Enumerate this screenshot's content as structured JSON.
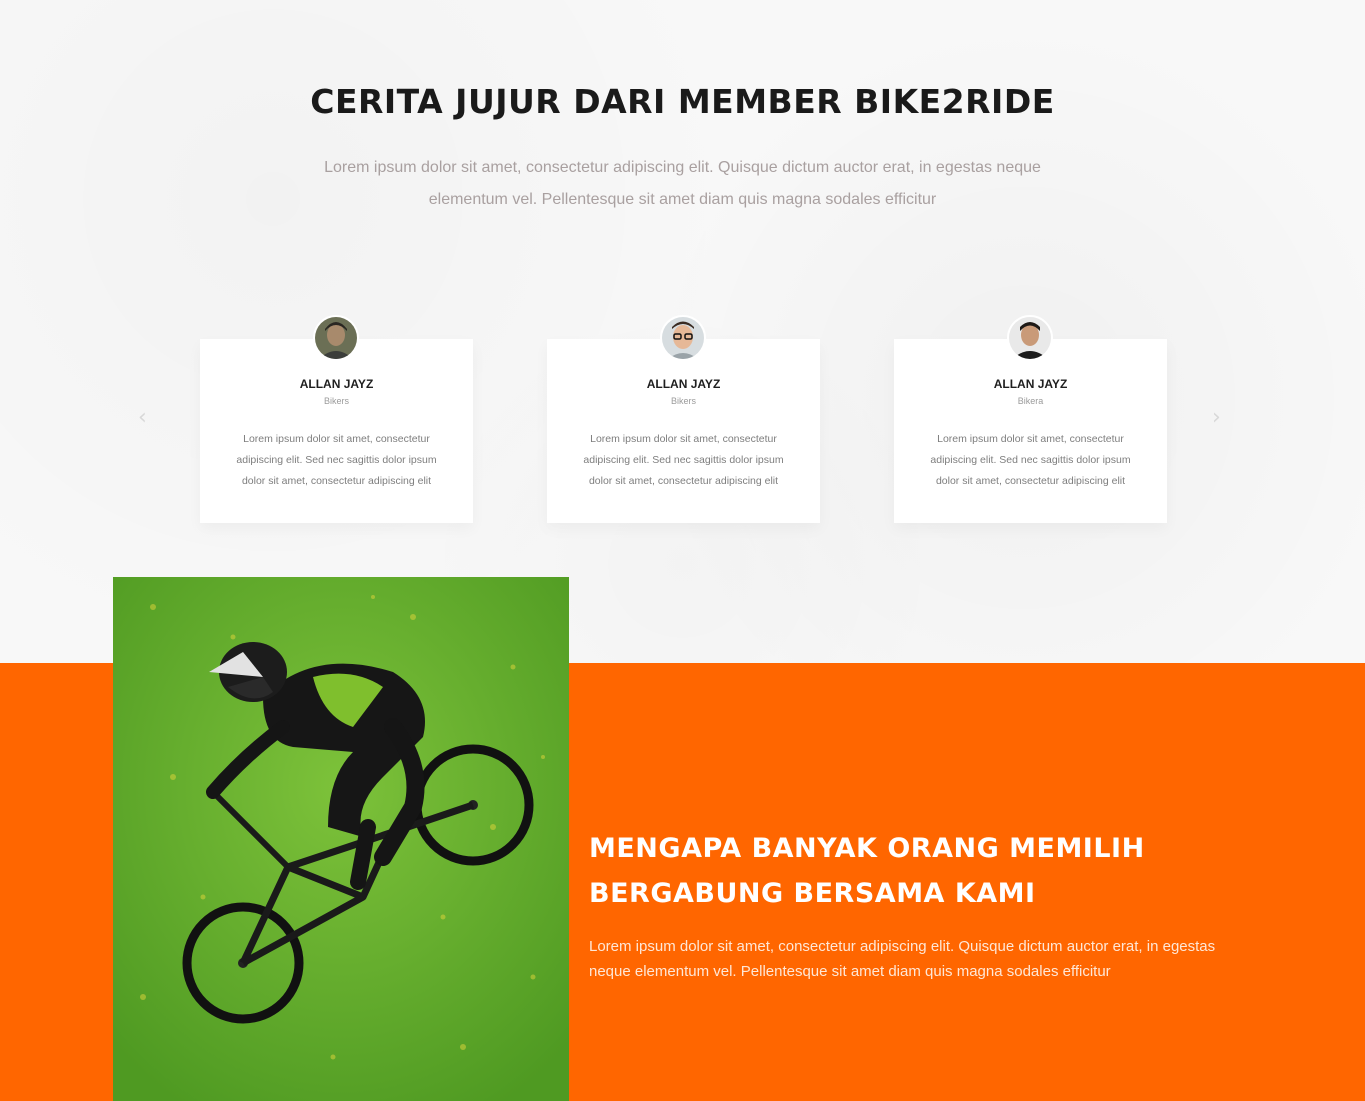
{
  "testimonials_section": {
    "title": "CERITA JUJUR DARI MEMBER BIKE2RIDE",
    "description": "Lorem ipsum dolor sit amet, consectetur adipiscing elit. Quisque dictum auctor erat, in egestas neque elementum vel. Pellentesque sit amet diam quis magna sodales efficitur",
    "prev_icon": "chevron-left-icon",
    "next_icon": "chevron-right-icon",
    "prev_glyph": "‹",
    "next_glyph": "›",
    "cards": [
      {
        "name": "ALLAN JAYZ",
        "role": "Bikers",
        "text": "Lorem ipsum dolor sit amet, consectetur adipiscing elit. Sed nec sagittis dolor ipsum dolor sit amet, consectetur adipiscing elit"
      },
      {
        "name": "ALLAN JAYZ",
        "role": "Bikers",
        "text": "Lorem ipsum dolor sit amet, consectetur adipiscing elit. Sed nec sagittis dolor ipsum dolor sit amet, consectetur adipiscing elit"
      },
      {
        "name": "ALLAN JAYZ",
        "role": "Bikera",
        "text": "Lorem ipsum dolor sit amet, consectetur adipiscing elit. Sed nec sagittis dolor ipsum dolor sit amet, consectetur adipiscing elit"
      }
    ]
  },
  "why_section": {
    "title_line1": "MENGAPA BANYAK ORANG MEMILIH",
    "title_line2": "BERGABUNG BERSAMA KAMI",
    "description": "Lorem ipsum dolor sit amet, consectetur adipiscing elit. Quisque dictum auctor erat, in egestas neque elementum vel. Pellentesque sit amet diam quis magna sodales efficitur"
  },
  "colors": {
    "accent": "#ff6600",
    "heading": "#1a1a1a",
    "muted_text": "#a9a0a0",
    "card_bg": "#ffffff",
    "grass": "#5fa82a"
  }
}
